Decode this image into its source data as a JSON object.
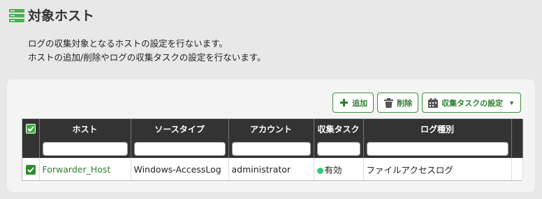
{
  "header": {
    "title": "対象ホスト",
    "icon": "server-list-icon"
  },
  "description": {
    "line1": "ログの収集対象となるホストの設定を行ないます。",
    "line2": "ホストの追加/削除やログの収集タスクの設定を行ないます。"
  },
  "toolbar": {
    "add_label": "追加",
    "delete_label": "削除",
    "task_label": "収集タスクの設定"
  },
  "table": {
    "columns": [
      "ホスト",
      "ソースタイプ",
      "アカウント",
      "収集タスク",
      "ログ種別"
    ],
    "filters": [
      "",
      "",
      "",
      "",
      ""
    ],
    "rows": [
      {
        "checked": true,
        "host": "Forwarder_Host",
        "source_type": "Windows-AccessLog",
        "account": "administrator",
        "task": "有効",
        "log_type": "ファイルアクセスログ"
      }
    ]
  },
  "colors": {
    "accent": "#2e7d2e",
    "status_enabled": "#2ecc71",
    "header_bg": "#333333"
  }
}
